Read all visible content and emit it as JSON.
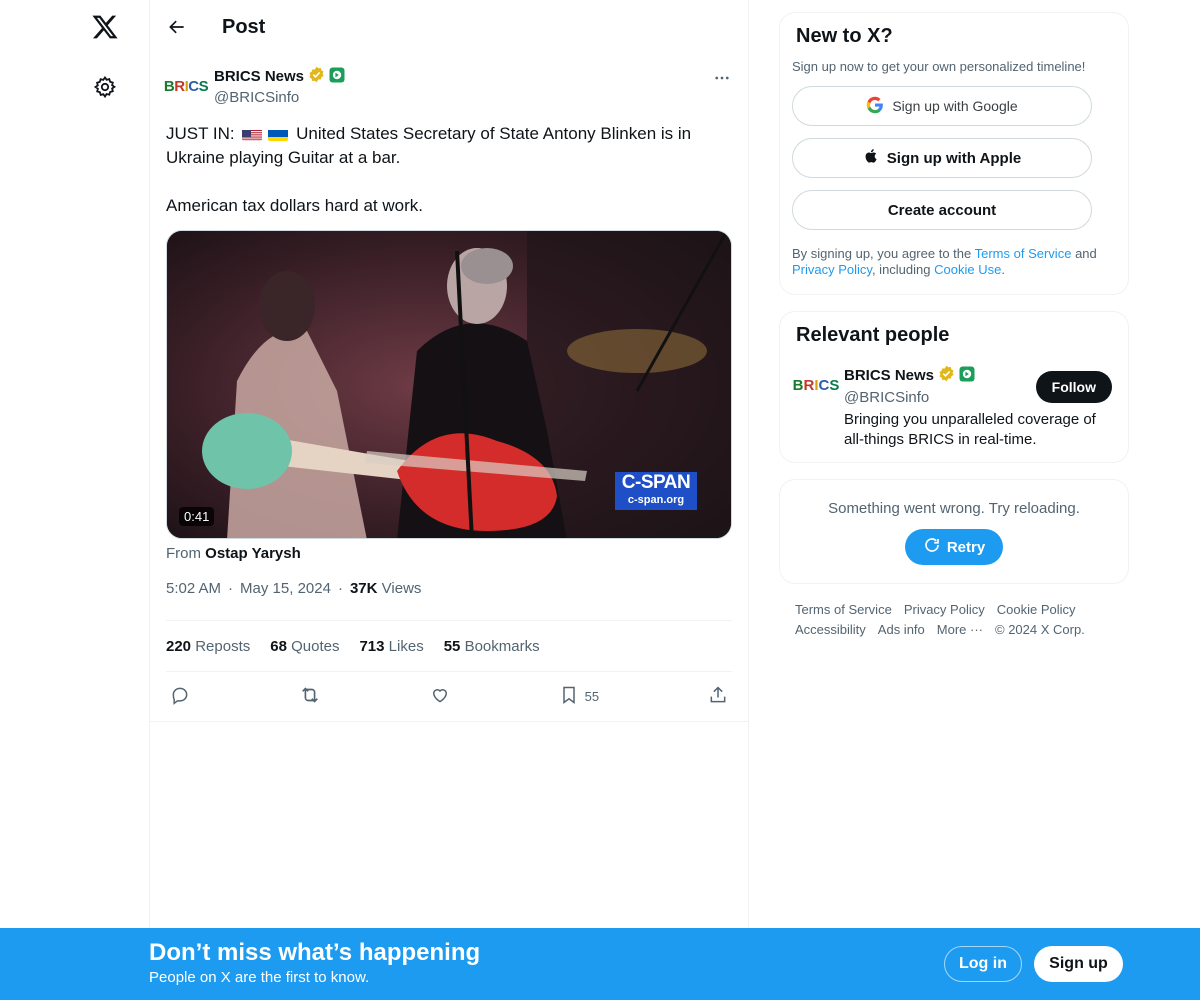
{
  "nav": {
    "logo_icon": "x-logo-icon",
    "settings_icon": "gear-icon"
  },
  "header": {
    "title": "Post"
  },
  "post": {
    "author_name": "BRICS News",
    "author_handle": "@BRICSinfo",
    "avatar_text": [
      "B",
      "R",
      "I",
      "C",
      "S"
    ],
    "text_prefix": "JUST IN:",
    "text_line1_rest": "United States Secretary of State Antony Blinken is in Ukraine playing Guitar at a bar.",
    "text_line2": "American tax dollars hard at work.",
    "video": {
      "duration": "0:41",
      "watermark_title": "C-SPAN",
      "watermark_url": "c-span.org"
    },
    "from_label": "From",
    "from_name": "Ostap Yarysh",
    "time": "5:02 AM",
    "date": "May 15, 2024",
    "views_count": "37K",
    "views_label": "Views",
    "stats": [
      {
        "count": "220",
        "label": "Reposts"
      },
      {
        "count": "68",
        "label": "Quotes"
      },
      {
        "count": "713",
        "label": "Likes"
      },
      {
        "count": "55",
        "label": "Bookmarks"
      }
    ],
    "bookmark_count": "55"
  },
  "signup_card": {
    "title": "New to X?",
    "subtitle": "Sign up now to get your own personalized timeline!",
    "google_label": "Sign up with Google",
    "apple_label": "Sign up with Apple",
    "create_label": "Create account",
    "legal_prefix": "By signing up, you agree to the",
    "terms_link": "Terms of Service",
    "legal_and": "and",
    "privacy_link": "Privacy Policy",
    "legal_including": ", including",
    "cookie_link": "Cookie Use",
    "legal_end": "."
  },
  "relevant": {
    "title": "Relevant people",
    "name": "BRICS News",
    "handle": "@BRICSinfo",
    "bio": "Bringing you unparalleled coverage of all-things BRICS in real-time.",
    "follow_label": "Follow"
  },
  "error_card": {
    "message": "Something went wrong. Try reloading.",
    "retry_label": "Retry"
  },
  "footer": {
    "links": [
      "Terms of Service",
      "Privacy Policy",
      "Cookie Policy",
      "Accessibility",
      "Ads info",
      "More ···",
      "© 2024 X Corp."
    ]
  },
  "banner": {
    "title": "Don’t miss what’s happening",
    "subtitle": "People on X are the first to know.",
    "login_label": "Log in",
    "signup_label": "Sign up"
  },
  "colors": {
    "accent": "#1d9bf0",
    "text": "#0f1419",
    "muted": "#536471",
    "verified_gold": "#e2b719"
  }
}
